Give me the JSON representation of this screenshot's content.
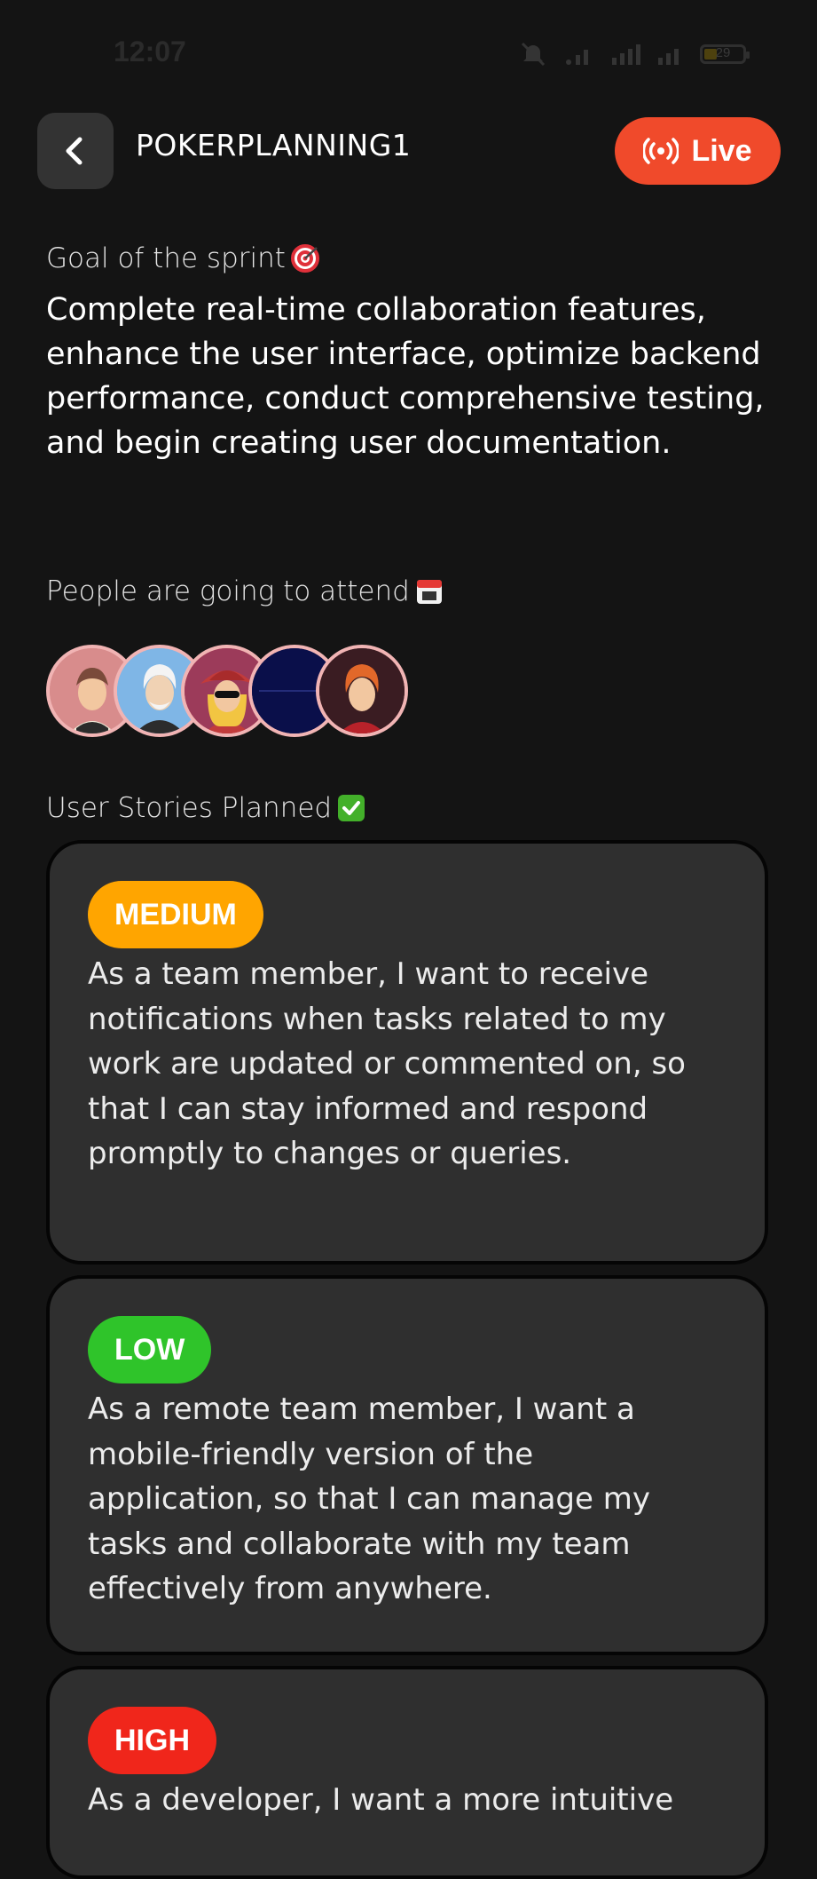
{
  "status_bar": {
    "time": "12:07",
    "battery": "29",
    "icons": [
      "mute-icon",
      "wifi-icon",
      "signal-icon",
      "signal-icon",
      "battery-icon"
    ]
  },
  "header": {
    "title": "POKERPLANNING1",
    "back_icon": "chevron-left-icon",
    "live_label": "Live",
    "live_icon": "broadcast-icon"
  },
  "goal": {
    "label": "Goal of the sprint",
    "label_icon": "target-emoji",
    "text": "Complete real-time collaboration features, enhance the user interface, optimize backend performance, conduct comprehensive testing, and begin creating user documentation."
  },
  "attendees": {
    "label": "People are going to attend",
    "label_icon": "calendar-emoji",
    "avatars": [
      {
        "name": "avatar-1",
        "bg": "#d88c8c"
      },
      {
        "name": "avatar-2",
        "bg": "#7fb6e6"
      },
      {
        "name": "avatar-3",
        "bg": "#c04a4a"
      },
      {
        "name": "avatar-4",
        "bg": "#0a0f4a"
      },
      {
        "name": "avatar-5",
        "bg": "#3a1c22"
      }
    ]
  },
  "stories": {
    "label": "User Stories Planned",
    "label_icon": "check-emoji",
    "items": [
      {
        "priority": "MEDIUM",
        "color": "#ffa500",
        "text": "As a team member, I want to receive notifications when tasks related to my work are updated or commented on, so that I can stay informed and respond promptly to changes or queries."
      },
      {
        "priority": "LOW",
        "color": "#2fc42a",
        "text": "As a remote team member, I want a mobile-friendly version of the application, so that I can manage my tasks and collaborate with my team effectively from anywhere."
      },
      {
        "priority": "HIGH",
        "color": "#f0261b",
        "text": "As a developer, I want a more intuitive"
      }
    ]
  },
  "colors": {
    "background": "#141414",
    "card": "#2f2f2f",
    "live": "#f04a2b"
  }
}
